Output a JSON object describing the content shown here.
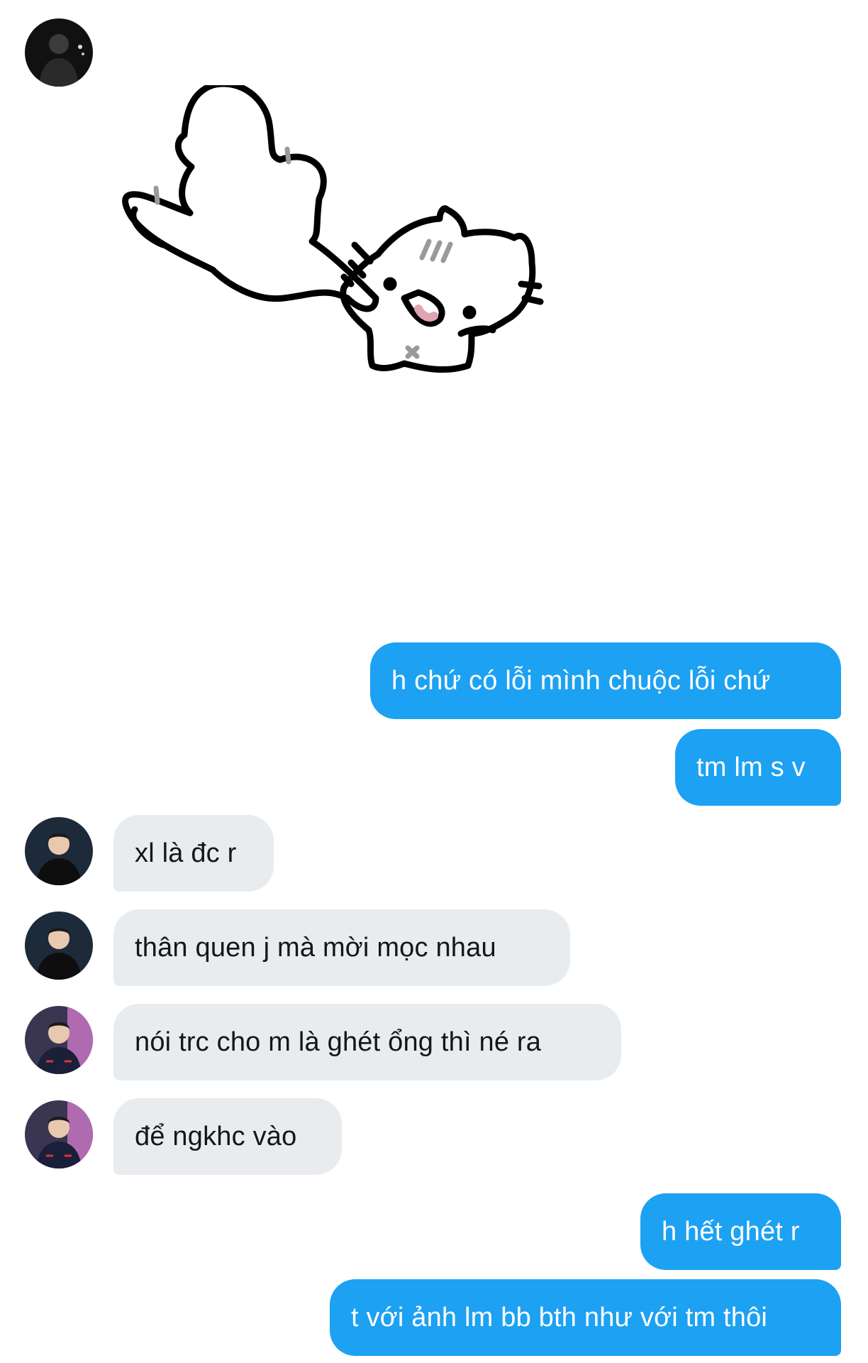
{
  "messages": {
    "m1": "h chứ có lỗi mình chuộc lỗi chứ",
    "m2": "tm lm s v",
    "m3": "xl là đc r",
    "m4": "thân quen j mà mời mọc nhau",
    "m5": "nói trc cho m là ghét ổng thì né ra",
    "m6": "để ngkhc vào",
    "m7": "h hết ghét r",
    "m8": "t với ảnh lm bb bth như với tm thôi"
  },
  "colors": {
    "outgoing_bubble": "#1da1f2",
    "incoming_bubble": "#e9ecef",
    "incoming_text": "#14171a"
  }
}
